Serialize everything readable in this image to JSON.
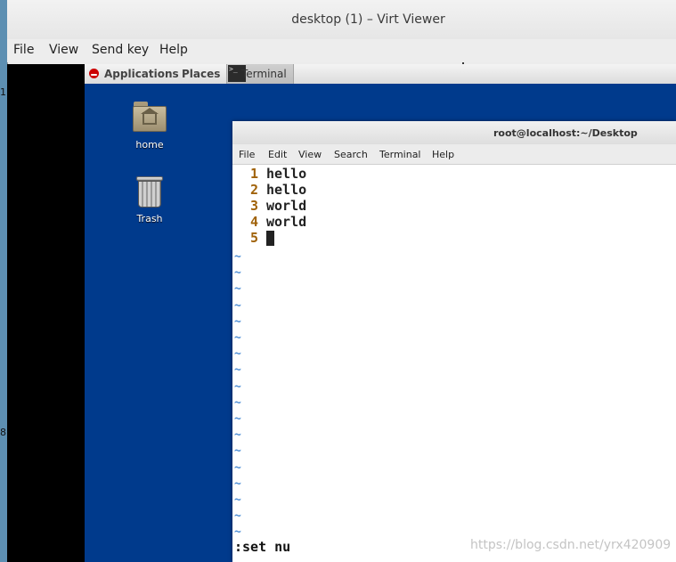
{
  "host": {
    "side_marks": [
      "1",
      "8"
    ]
  },
  "viewer": {
    "title": "desktop (1) – Virt Viewer",
    "menu": [
      "File",
      "View",
      "Send key",
      "Help"
    ]
  },
  "guest_panel": {
    "applications": "Applications",
    "places": "Places",
    "taskbar_terminal": "Terminal",
    "terminal_task_icon_glyph": ">_"
  },
  "desktop_icons": [
    {
      "label": "home",
      "icon": "home-folder-icon"
    },
    {
      "label": "Trash",
      "icon": "trash-icon"
    }
  ],
  "terminal": {
    "title": "root@localhost:~/Desktop",
    "menu": [
      "File",
      "Edit",
      "View",
      "Search",
      "Terminal",
      "Help"
    ]
  },
  "vim": {
    "lines": [
      {
        "num": "1",
        "text": "hello"
      },
      {
        "num": "2",
        "text": "hello"
      },
      {
        "num": "3",
        "text": "world"
      },
      {
        "num": "4",
        "text": "world"
      },
      {
        "num": "5",
        "text": ""
      }
    ],
    "tilde": "~",
    "command": ":set nu"
  },
  "watermark": "https://blog.csdn.net/yrx420909",
  "colors": {
    "desktop_bg": "#003a8c",
    "line_number": "#a0620a",
    "tilde": "#4f8fd6"
  }
}
